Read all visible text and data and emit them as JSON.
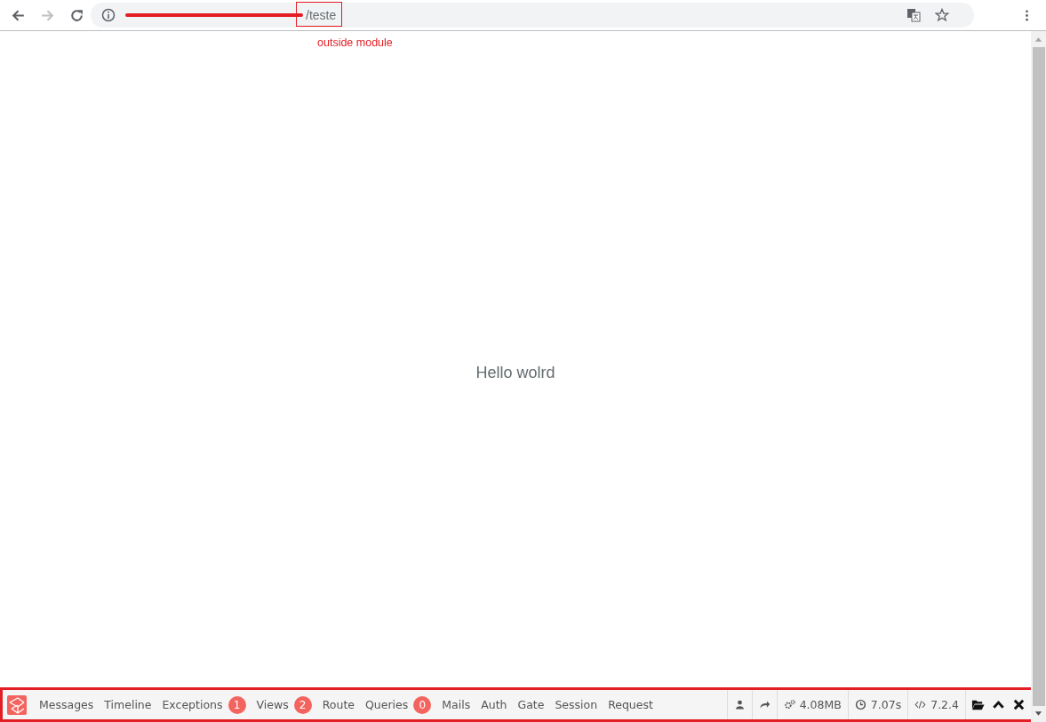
{
  "browser": {
    "back_enabled": true,
    "forward_enabled": false,
    "address": {
      "text": "/teste"
    }
  },
  "annotation": {
    "note": "outside module"
  },
  "page": {
    "heading": "Hello wolrd"
  },
  "debugbar": {
    "tabs": [
      {
        "label": "Messages"
      },
      {
        "label": "Timeline"
      },
      {
        "label": "Exceptions",
        "badge": "1"
      },
      {
        "label": "Views",
        "badge": "2"
      },
      {
        "label": "Route"
      },
      {
        "label": "Queries",
        "badge": "0"
      },
      {
        "label": "Mails"
      },
      {
        "label": "Auth"
      },
      {
        "label": "Gate"
      },
      {
        "label": "Session"
      },
      {
        "label": "Request"
      }
    ],
    "indicators": [
      {
        "kind": "user"
      },
      {
        "kind": "redirect"
      },
      {
        "kind": "memory",
        "text": "4.08MB"
      },
      {
        "kind": "time",
        "text": "7.07s"
      },
      {
        "kind": "version",
        "text": "7.2.4"
      }
    ]
  }
}
